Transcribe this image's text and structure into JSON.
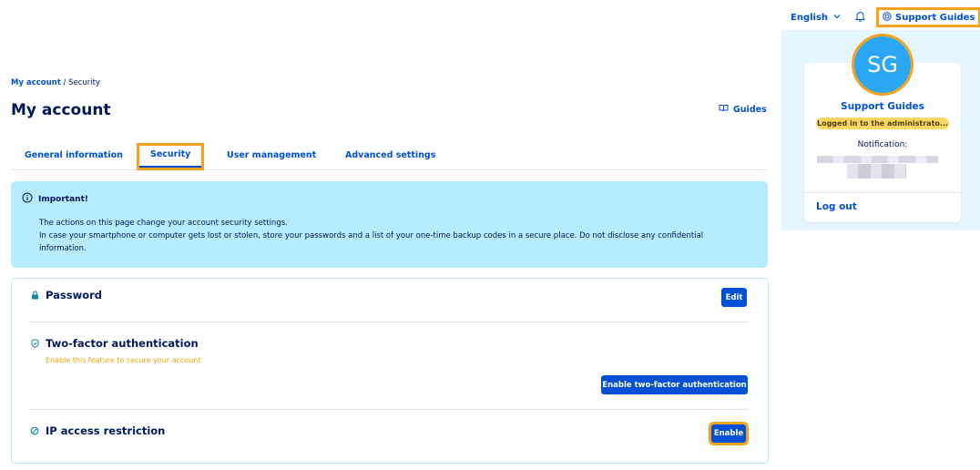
{
  "topbar": {
    "language": "English",
    "support_label": "Support Guides",
    "icons": [
      "chevron-down-icon",
      "bell-icon",
      "question-circle-icon"
    ]
  },
  "user_panel": {
    "avatar_initials": "SG",
    "name": "Support Guides",
    "logged_in_badge": "Logged in to the administrato...",
    "notification_label": "Notification:",
    "logout_label": "Log out"
  },
  "breadcrumb": {
    "root": "My account",
    "separator": "/",
    "current": "Security"
  },
  "page": {
    "title": "My account",
    "guides_label": "Guides"
  },
  "tabs": [
    {
      "label": "General information",
      "active": false
    },
    {
      "label": "Security",
      "active": true
    },
    {
      "label": "User management",
      "active": false
    },
    {
      "label": "Advanced settings",
      "active": false
    }
  ],
  "notice": {
    "heading": "Important!",
    "line1": "The actions on this page change your account security settings.",
    "line2": "In case your smartphone or computer gets lost or stolen, store your passwords and a list of your one-time backup codes in a secure place. Do not disclose any confidential information."
  },
  "security": {
    "password": {
      "title": "Password",
      "button": "Edit",
      "icon": "lock-icon"
    },
    "two_factor": {
      "title": "Two-factor authentication",
      "subtitle": "Enable this feature to secure your account.",
      "button": "Enable two-factor authentication",
      "icon": "shield-icon"
    },
    "ip_restriction": {
      "title": "IP access restriction",
      "button": "Enable",
      "icon": "block-icon"
    }
  },
  "colors": {
    "primary": "#0050d7",
    "text": "#00185e",
    "notice_bg": "#b6ecfe",
    "highlight": "#f5a21e",
    "warning_text": "#f2a400",
    "panel_bg": "#e6f6fe"
  }
}
